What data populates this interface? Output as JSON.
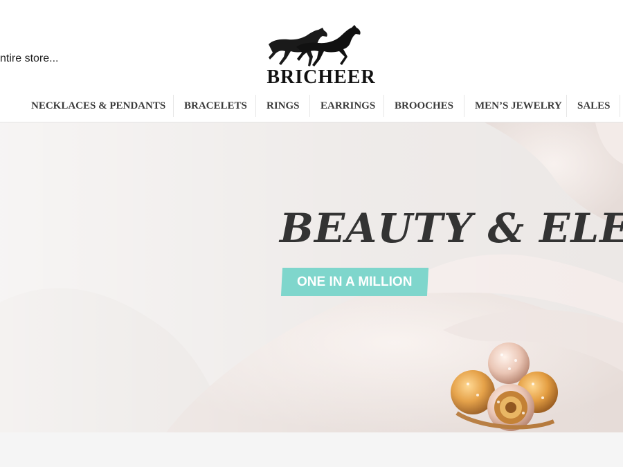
{
  "header": {
    "search_text": "ntire store...",
    "logo": {
      "brand": "BRICHEER",
      "icon": "two-running-horses-logo"
    }
  },
  "nav": {
    "items": [
      {
        "label": "NECKLACES & PENDANTS"
      },
      {
        "label": "BRACELETS"
      },
      {
        "label": "RINGS"
      },
      {
        "label": "EARRINGS"
      },
      {
        "label": "BROOCHES"
      },
      {
        "label": "MEN’S JEWELRY"
      },
      {
        "label": "SALES"
      }
    ]
  },
  "hero": {
    "title": "BEAUTY & ELEG",
    "badge": "ONE IN A MILLION",
    "image": "hand-wearing-gold-rings-photo",
    "badge_color": "#7fd6cc"
  }
}
